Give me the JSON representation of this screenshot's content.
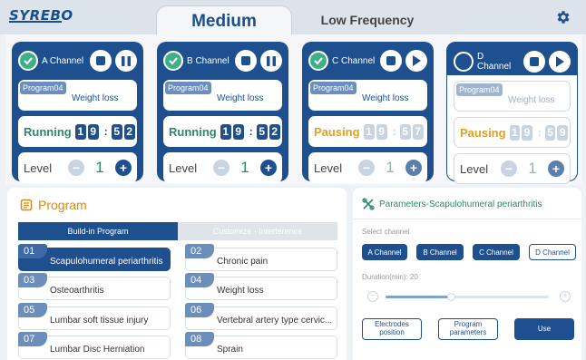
{
  "app": {
    "logo": "SYREBO"
  },
  "tabs": {
    "medium": "Medium",
    "low": "Low Frequency"
  },
  "channels": [
    {
      "name": "A Channel",
      "program_tag": "Program04",
      "program_name": "Weight loss",
      "status": "Running",
      "status_color": "#2b8a6a",
      "time": [
        "1",
        "9",
        "5",
        "2"
      ],
      "level_label": "Level",
      "level": "1",
      "play_state": "pause",
      "active": true
    },
    {
      "name": "B Channel",
      "program_tag": "Program04",
      "program_name": "Weight loss",
      "status": "Running",
      "status_color": "#2b8a6a",
      "time": [
        "1",
        "9",
        "5",
        "2"
      ],
      "level_label": "Level",
      "level": "1",
      "play_state": "pause",
      "active": true
    },
    {
      "name": "C Channel",
      "program_tag": "Program04",
      "program_name": "Weight loss",
      "status": "Pausing",
      "status_color": "#e0a020",
      "time": [
        "1",
        "9",
        "5",
        "7"
      ],
      "level_label": "Level",
      "level": "1",
      "play_state": "play",
      "active": true
    },
    {
      "name": "D Channel",
      "program_tag": "Program04",
      "program_name": "Weight loss",
      "status": "Pausing",
      "status_color": "#e0a020",
      "time": [
        "1",
        "9",
        "5",
        "9"
      ],
      "level_label": "Level",
      "level": "1",
      "play_state": "play",
      "active": false
    }
  ],
  "program": {
    "title": "Program",
    "tab_builtin": "Build-in Program",
    "tab_custom": "Customize - Interference",
    "items": [
      {
        "num": "01",
        "label": "Scapulohumeral periarthritis"
      },
      {
        "num": "02",
        "label": "Chronic pain"
      },
      {
        "num": "03",
        "label": "Osteoarthritis"
      },
      {
        "num": "04",
        "label": "Weight loss"
      },
      {
        "num": "05",
        "label": "Lumbar soft tissue injury"
      },
      {
        "num": "06",
        "label": "Vertebral artery type cervic..."
      },
      {
        "num": "07",
        "label": "Lumbar Disc Herniation"
      },
      {
        "num": "08",
        "label": "Sprain"
      }
    ]
  },
  "params": {
    "title": "Parameters-Scapulohumeral periarthritis",
    "select_label": "Select channel",
    "ch_a": "A Channel",
    "ch_b": "B Channel",
    "ch_c": "C Channel",
    "ch_d": "D Channel",
    "duration_label": "Duration(min): 20",
    "duration_fraction": 0.4,
    "btn_electrodes": "Electrodes position",
    "btn_program": "Program parameters",
    "btn_use": "Use"
  },
  "colors": {
    "primary": "#1e4f8f",
    "running": "#2b8a6a",
    "pausing": "#e0a020",
    "accent": "#d98a12"
  }
}
